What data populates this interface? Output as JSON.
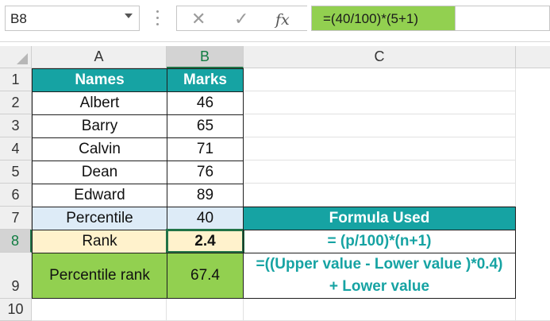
{
  "formula_bar": {
    "name_box": "B8",
    "cancel_icon": "close-icon",
    "enter_icon": "check-icon",
    "fx_label": "fx",
    "formula": "=(40/100)*(5+1)"
  },
  "columns": [
    "A",
    "B",
    "C"
  ],
  "rows": [
    "1",
    "2",
    "3",
    "4",
    "5",
    "6",
    "7",
    "8",
    "9",
    "10"
  ],
  "table": {
    "header_names": "Names",
    "header_marks": "Marks",
    "entries": [
      {
        "name": "Albert",
        "mark": "46"
      },
      {
        "name": "Barry",
        "mark": "65"
      },
      {
        "name": "Calvin",
        "mark": "71"
      },
      {
        "name": "Dean",
        "mark": "76"
      },
      {
        "name": "Edward",
        "mark": "89"
      }
    ],
    "percentile_label": "Percentile",
    "percentile_value": "40",
    "rank_label": "Rank",
    "rank_value": "2.4",
    "percentile_rank_label": "Percentile rank",
    "percentile_rank_value": "67.4"
  },
  "formula_box": {
    "title": "Formula Used",
    "rank_formula": "= (p/100)*(n+1)",
    "pr_formula_line1": "=((Upper value - Lower value )*0.4)",
    "pr_formula_line2": "+ Lower value"
  },
  "colors": {
    "teal": "#16a3a3",
    "green": "#92d050",
    "light_blue": "#ddebf7",
    "beige": "#fff2cc",
    "selection": "#217346"
  }
}
